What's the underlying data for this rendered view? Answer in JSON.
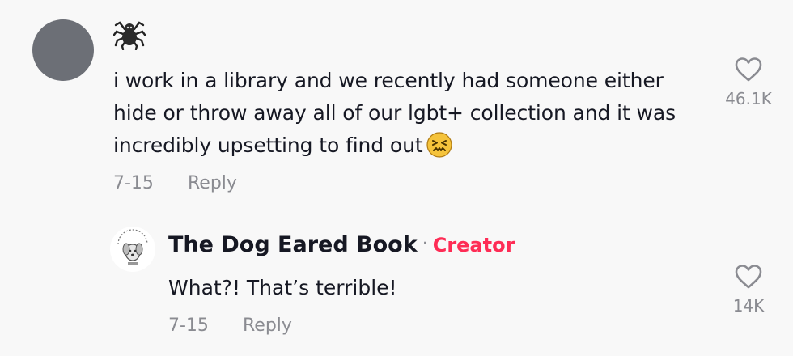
{
  "comment": {
    "username_icon": "spider-emoji-icon",
    "text": "i work in a library and we recently had someone either hide or throw away all of our lgbt+ collection and it was incredibly upsetting to find out",
    "text_emoji": "confounded-face-emoji-icon",
    "date": "7-15",
    "reply_label": "Reply",
    "like_count": "46.1K"
  },
  "reply": {
    "author": "The Dog Eared Book",
    "separator": "·",
    "badge": "Creator",
    "text": "What?! That’s terrible!",
    "date": "7-15",
    "reply_label": "Reply",
    "like_count": "14K"
  },
  "colors": {
    "background": "#f8f8f8",
    "text": "#161823",
    "muted": "#8a8b91",
    "creator_accent": "#fe2c55",
    "avatar_gray": "#6c6f76"
  }
}
